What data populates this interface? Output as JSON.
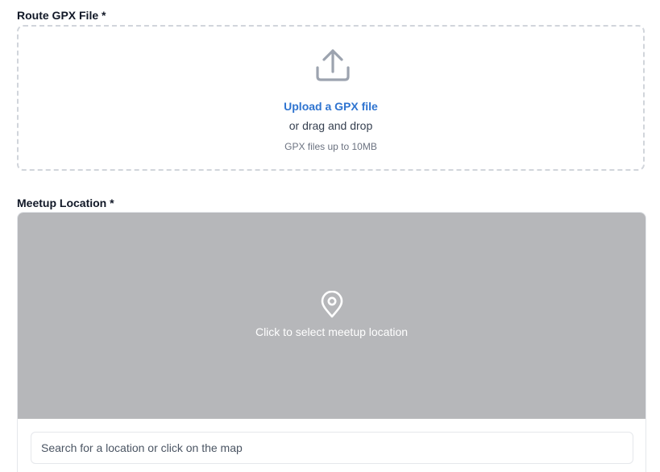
{
  "gpx_field": {
    "label": "Route GPX File *",
    "icon": "upload-icon",
    "upload_link": "Upload a GPX file",
    "or_text": "or drag and drop",
    "hint": "GPX files up to 10MB"
  },
  "meetup_field": {
    "label": "Meetup Location *",
    "map": {
      "icon": "map-pin-icon",
      "hint": "Click to select meetup location",
      "background_color": "#b6b7ba"
    },
    "search": {
      "value": "",
      "placeholder": "Search for a location or click on the map"
    }
  },
  "colors": {
    "accent": "#2f74d0",
    "dropzone_border": "#d1d5db"
  }
}
